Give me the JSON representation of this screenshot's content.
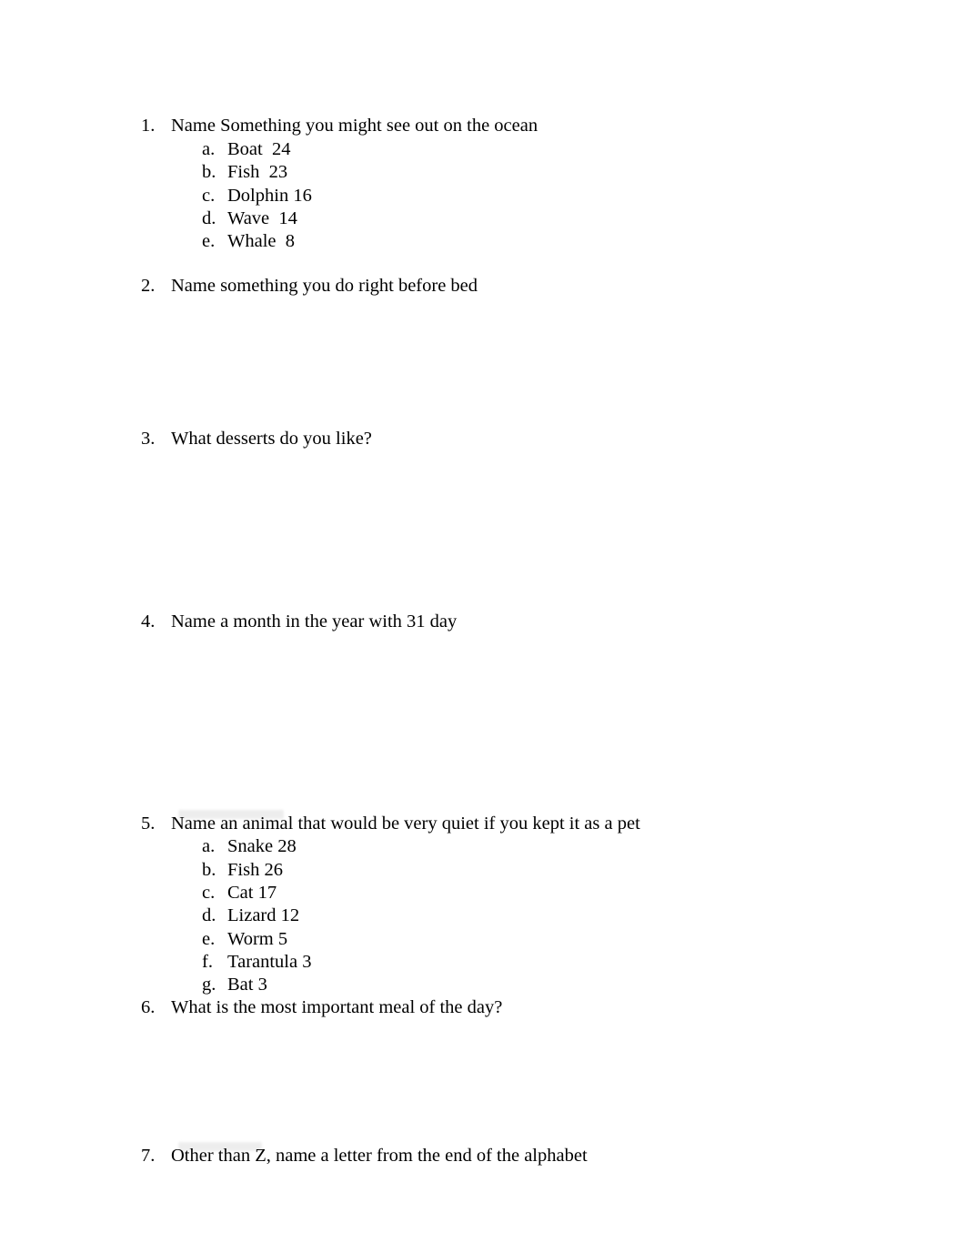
{
  "document": {
    "background_color": "#ffffff",
    "text_color": "#000000",
    "questions": [
      {
        "marker": "1.",
        "text": "Name Something you might see out on the ocean",
        "answers": [
          {
            "marker": "a.",
            "text": "Boat  24"
          },
          {
            "marker": "b.",
            "text": "Fish  23"
          },
          {
            "marker": "c.",
            "text": "Dolphin 16"
          },
          {
            "marker": "d.",
            "text": "Wave  14"
          },
          {
            "marker": "e.",
            "text": "Whale  8"
          }
        ]
      },
      {
        "marker": "2.",
        "text": "Name something you do right before bed",
        "answers": []
      },
      {
        "marker": "3.",
        "text": "What desserts do you like?",
        "answers": []
      },
      {
        "marker": "4.",
        "text": "Name a month in the year with 31 day",
        "answers": []
      },
      {
        "marker": "5.",
        "text": "Name an animal that would be very quiet if you kept it as a pet",
        "answers": [
          {
            "marker": "a.",
            "text": "Snake 28"
          },
          {
            "marker": "b.",
            "text": "Fish 26"
          },
          {
            "marker": "c.",
            "text": "Cat 17"
          },
          {
            "marker": "d.",
            "text": "Lizard 12"
          },
          {
            "marker": "e.",
            "text": "Worm 5"
          },
          {
            "marker": "f.",
            "text": "Tarantula 3"
          },
          {
            "marker": "g.",
            "text": "Bat 3"
          }
        ]
      },
      {
        "marker": "6.",
        "text": "What is the most important meal of the day?",
        "answers": []
      },
      {
        "marker": "7.",
        "text": "Other than Z, name a letter from the end of the alphabet",
        "answers": []
      }
    ]
  }
}
